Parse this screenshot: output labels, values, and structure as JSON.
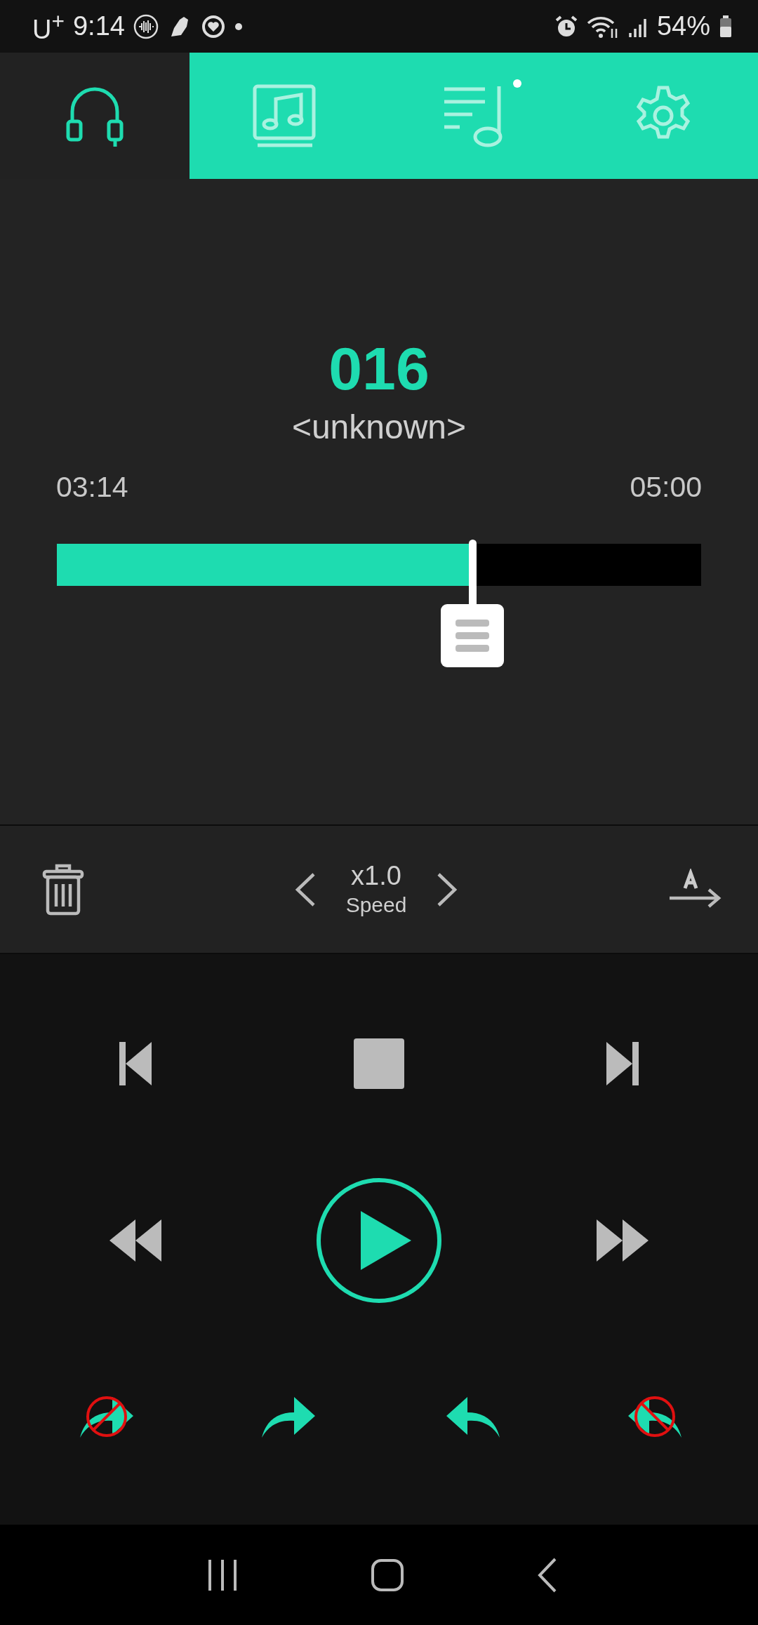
{
  "status_bar": {
    "carrier": "U$^{+}$",
    "time": "9:14",
    "battery": "54%"
  },
  "tabs": [
    {
      "kind": "headphones",
      "selected": true,
      "dot": false
    },
    {
      "kind": "album",
      "selected": false,
      "dot": false
    },
    {
      "kind": "playlist",
      "selected": false,
      "dot": true
    },
    {
      "kind": "settings",
      "selected": false,
      "dot": false
    }
  ],
  "player": {
    "track": "016",
    "artist": "<unknown>",
    "elapsed": "03:14",
    "total": "05:00",
    "level": 0.645
  },
  "speed": {
    "value": "x1.0",
    "label": "Speed"
  },
  "transport": [
    {
      "kind": "previous"
    },
    {
      "kind": "stop"
    },
    {
      "kind": "next"
    }
  ],
  "seek": [
    {
      "kind": "rewind"
    },
    {
      "kind": "play"
    },
    {
      "kind": "fast-forward"
    }
  ],
  "repeat": [
    {
      "kind": "forward",
      "disabled": true
    },
    {
      "kind": "forward",
      "disabled": false
    },
    {
      "kind": "back",
      "disabled": false
    },
    {
      "kind": "back",
      "disabled": true
    }
  ]
}
